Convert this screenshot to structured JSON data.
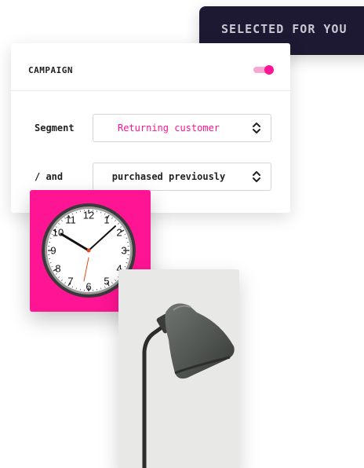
{
  "banner": {
    "text": "SELECTED FOR YOU"
  },
  "campaign": {
    "title": "CAMPAIGN",
    "toggle_on": true,
    "rows": [
      {
        "label": "Segment",
        "value": "Returning customer"
      },
      {
        "label": "/ and",
        "value": "purchased previously"
      }
    ]
  },
  "colors": {
    "accent": "#ff1493",
    "banner_bg": "#1d1933",
    "toggle_track": "#f6a8d5"
  },
  "products": [
    {
      "name": "clock-image",
      "numerals": [
        "12",
        "1",
        "2",
        "3",
        "4",
        "5",
        "6",
        "7",
        "8",
        "9",
        "10",
        "11"
      ]
    },
    {
      "name": "lamp-image"
    }
  ]
}
